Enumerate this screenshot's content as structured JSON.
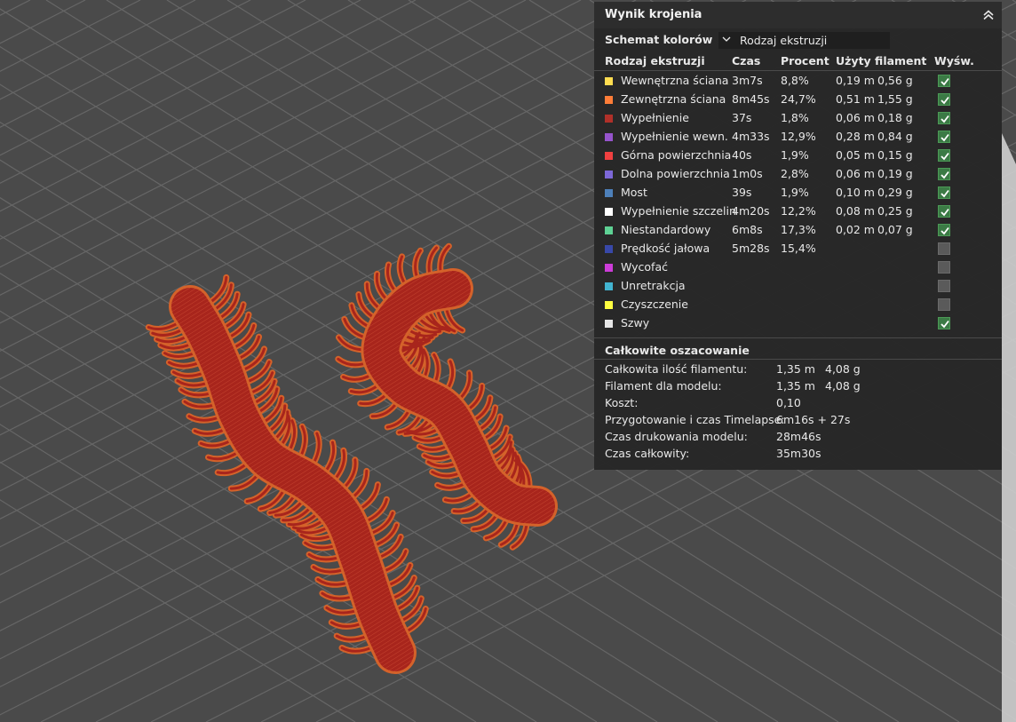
{
  "panel": {
    "title": "Wynik krojenia",
    "collapse_icon": "double-chevron-up-icon",
    "color_scheme_label": "Schemat kolorów",
    "color_scheme_value": "Rodzaj ekstruzji",
    "headers": {
      "type": "Rodzaj ekstruzji",
      "time": "Czas",
      "percent": "Procent",
      "filament": "Użyty filament",
      "show": "Wyśw."
    },
    "rows": [
      {
        "name": "Wewnętrzna ściana",
        "color": "#ffdc50",
        "time": "3m7s",
        "percent": "8,8%",
        "length": "0,19 m",
        "weight": "0,56 g",
        "visible": true
      },
      {
        "name": "Zewnętrzna ściana",
        "color": "#ff7d38",
        "time": "8m45s",
        "percent": "24,7%",
        "length": "0,51 m",
        "weight": "1,55 g",
        "visible": true
      },
      {
        "name": "Wypełnienie",
        "color": "#b03029",
        "time": "37s",
        "percent": "1,8%",
        "length": "0,06 m",
        "weight": "0,18 g",
        "visible": true
      },
      {
        "name": "Wypełnienie wewn.",
        "color": "#9654cc",
        "time": "4m33s",
        "percent": "12,9%",
        "length": "0,28 m",
        "weight": "0,84 g",
        "visible": true
      },
      {
        "name": "Górna powierzchnia",
        "color": "#f04040",
        "time": "40s",
        "percent": "1,9%",
        "length": "0,05 m",
        "weight": "0,15 g",
        "visible": true
      },
      {
        "name": "Dolna powierzchnia",
        "color": "#7d68d8",
        "time": "1m0s",
        "percent": "2,8%",
        "length": "0,06 m",
        "weight": "0,19 g",
        "visible": true
      },
      {
        "name": "Most",
        "color": "#4d80ba",
        "time": "39s",
        "percent": "1,9%",
        "length": "0,10 m",
        "weight": "0,29 g",
        "visible": true
      },
      {
        "name": "Wypełnienie szczelin",
        "color": "#ffffff",
        "time": "4m20s",
        "percent": "12,2%",
        "length": "0,08 m",
        "weight": "0,25 g",
        "visible": true
      },
      {
        "name": "Niestandardowy",
        "color": "#5ed194",
        "time": "6m8s",
        "percent": "17,3%",
        "length": "0,02 m",
        "weight": "0,07 g",
        "visible": true
      },
      {
        "name": "Prędkość jałowa",
        "color": "#3848a8",
        "time": "5m28s",
        "percent": "15,4%",
        "length": "",
        "weight": "",
        "visible": false
      },
      {
        "name": "Wycofać",
        "color": "#cc3cd8",
        "time": "",
        "percent": "",
        "length": "",
        "weight": "",
        "visible": false
      },
      {
        "name": "Unretrakcja",
        "color": "#42b4d0",
        "time": "",
        "percent": "",
        "length": "",
        "weight": "",
        "visible": false
      },
      {
        "name": "Czyszczenie",
        "color": "#ffff40",
        "time": "",
        "percent": "",
        "length": "",
        "weight": "",
        "visible": false
      },
      {
        "name": "Szwy",
        "color": "#e6e6e6",
        "time": "",
        "percent": "",
        "length": "",
        "weight": "",
        "visible": true
      }
    ],
    "totals_title": "Całkowite oszacowanie",
    "totals": [
      {
        "label": "Całkowita ilość filamentu:",
        "v1": "1,35 m",
        "v2": "4,08 g"
      },
      {
        "label": "Filament dla modelu:",
        "v1": "1,35 m",
        "v2": "4,08 g"
      },
      {
        "label": "Koszt:",
        "v1": "0,10",
        "v2": ""
      },
      {
        "label": "Przygotowanie i czas Timelapse:",
        "v1": "6m16s + 27s",
        "v2": ""
      },
      {
        "label": "Czas drukowania modelu:",
        "v1": "28m46s",
        "v2": ""
      },
      {
        "label": "Czas całkowity:",
        "v1": "35m30s",
        "v2": ""
      }
    ]
  },
  "viewport": {
    "background_color": "#4a4a4a",
    "grid_color": "#666666",
    "model_fill_color": "#a8251c",
    "model_outline_color": "#d4622a"
  }
}
